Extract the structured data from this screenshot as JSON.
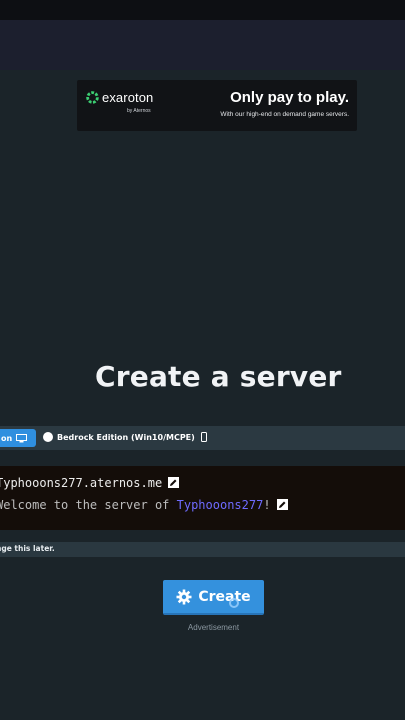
{
  "ad": {
    "brand": "exaroton",
    "brand_sub": "by Aternos",
    "headline": "Only pay to play.",
    "subtext": "With our high-end on demand game servers."
  },
  "page": {
    "title": "Create a server"
  },
  "edition": {
    "java_label": "on",
    "bedrock_label": "Bedrock Edition (Win10/MCPE)"
  },
  "preview": {
    "address": "Typhooons277.aternos.me",
    "motd_prefix": "Welcome to the server of ",
    "motd_name": "Typhooons277",
    "motd_suffix": "!"
  },
  "hint": {
    "text": "nge this later."
  },
  "actions": {
    "create_label": "Create",
    "advertisement_caption": "Advertisement"
  },
  "colors": {
    "background": "#1b2429",
    "accent": "#3491dd",
    "motd_name": "#6e6bff"
  }
}
